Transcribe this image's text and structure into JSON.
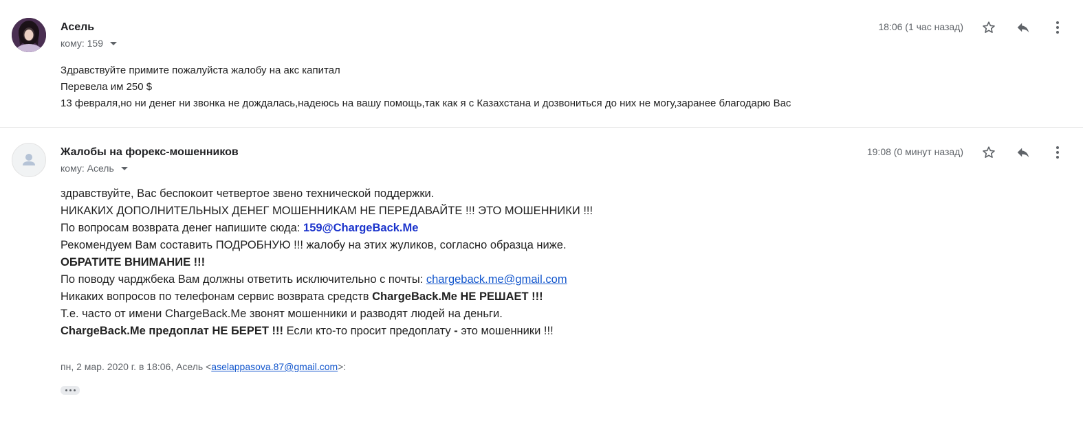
{
  "messages": [
    {
      "sender": "Асель",
      "to_label": "кому: 159",
      "time": "18:06 (1 час назад)",
      "lines": [
        "Здравствуйте примите пожалуйста жалобу на акс капитал",
        "Перевела им 250 $",
        "13 февраля,но ни денег ни звонка не дождалась,надеюсь на вашу помощь,так как я с Казахстана и дозвониться до них не могу,заранее благодарю Вас"
      ]
    },
    {
      "sender": "Жалобы на форекс-мошенников",
      "to_label": "кому: Асель",
      "time": "19:08 (0 минут назад)",
      "l1": "здравствуйте, Вас беспокоит четвертое звено технической поддержки.",
      "l2": "НИКАКИХ ДОПОЛНИТЕЛЬНЫХ ДЕНЕГ МОШЕННИКАМ НЕ ПЕРЕДАВАЙТЕ !!! ЭТО МОШЕННИКИ !!!",
      "l3_text": "По вопросам возврата денег напишите сюда: ",
      "l3_email": "159@ChargeBack.Me",
      "l4": "Рекомендуем Вам составить ПОДРОБНУЮ !!! жалобу на этих жуликов, согласно образца ниже.",
      "l5": "ОБРАТИТЕ ВНИМАНИЕ !!!",
      "l6_text": "По поводу чарджбека Вам должны ответить исключительно с почты: ",
      "l6_link": "chargeback.me@gmail.com",
      "l7_text": "Никаких вопросов по телефонам сервис возврата средств ",
      "l7_bold": "ChargeBack.Me НЕ РЕШАЕТ !!!",
      "l8": "Т.е. часто от имени ChargeBack.Me звонят мошенники и разводят людей на деньги.",
      "l9_bold1": "ChargeBack.Me предоплат НЕ БЕРЕТ !!!",
      "l9_text": " Если кто-то просит предоплату ",
      "l9_bold2": "-",
      "l9_text2": " это мошенники !!!",
      "quote_prefix": "пн, 2 мар. 2020 г. в 18:06, Асель <",
      "quote_email": "aselappasova.87@gmail.com",
      "quote_suffix": ">:"
    }
  ],
  "icons": {
    "star": "star-icon",
    "reply": "reply-icon",
    "more": "more-vert-icon",
    "ellipsis": "show-trimmed-content-icon"
  },
  "colors": {
    "link": "#1155cc",
    "email_bold": "#1a33cc",
    "meta": "#5f6368"
  }
}
